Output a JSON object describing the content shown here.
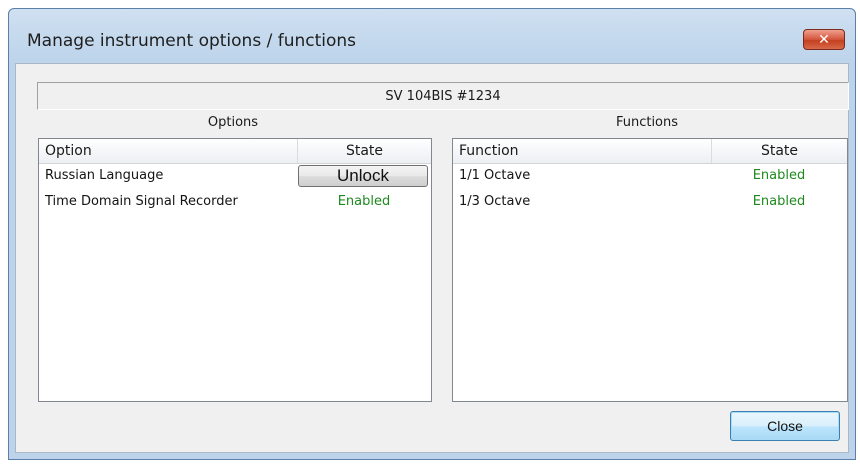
{
  "window": {
    "title": "Manage instrument options / functions",
    "close_glyph": "✕"
  },
  "instrument": {
    "name": "SV 104BIS #1234"
  },
  "options": {
    "label": "Options",
    "columns": [
      "Option",
      "State"
    ],
    "rows": [
      {
        "name": "Russian Language",
        "state": "Unlock",
        "state_type": "button"
      },
      {
        "name": "Time Domain Signal Recorder",
        "state": "Enabled",
        "state_type": "status"
      }
    ]
  },
  "functions": {
    "label": "Functions",
    "columns": [
      "Function",
      "State"
    ],
    "rows": [
      {
        "name": "1/1 Octave",
        "state": "Enabled"
      },
      {
        "name": "1/3 Octave",
        "state": "Enabled"
      }
    ]
  },
  "footer": {
    "close_label": "Close"
  },
  "colors": {
    "enabled_text": "#1e8a1e",
    "title_close_button": "#c3401f",
    "default_button_border": "#3c7fb1"
  }
}
